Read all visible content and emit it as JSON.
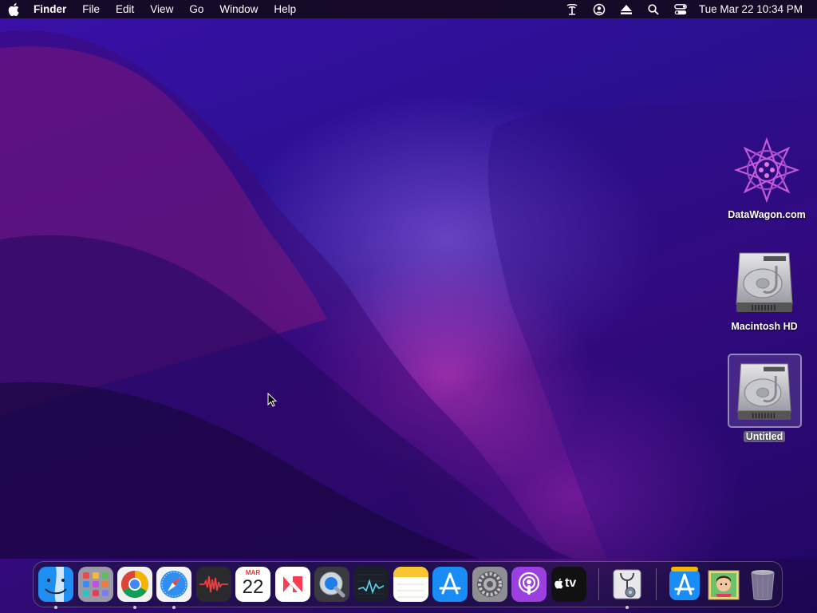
{
  "menubar": {
    "app_name": "Finder",
    "menus": [
      "File",
      "Edit",
      "View",
      "Go",
      "Window",
      "Help"
    ],
    "clock": "Tue Mar 22  10:34 PM"
  },
  "desktop_icons": [
    {
      "label": "DataWagon.com"
    },
    {
      "label": "Macintosh HD"
    },
    {
      "label": "Untitled"
    }
  ],
  "dock": {
    "calendar_month": "MAR",
    "calendar_day": "22",
    "tv_label": "tv"
  }
}
